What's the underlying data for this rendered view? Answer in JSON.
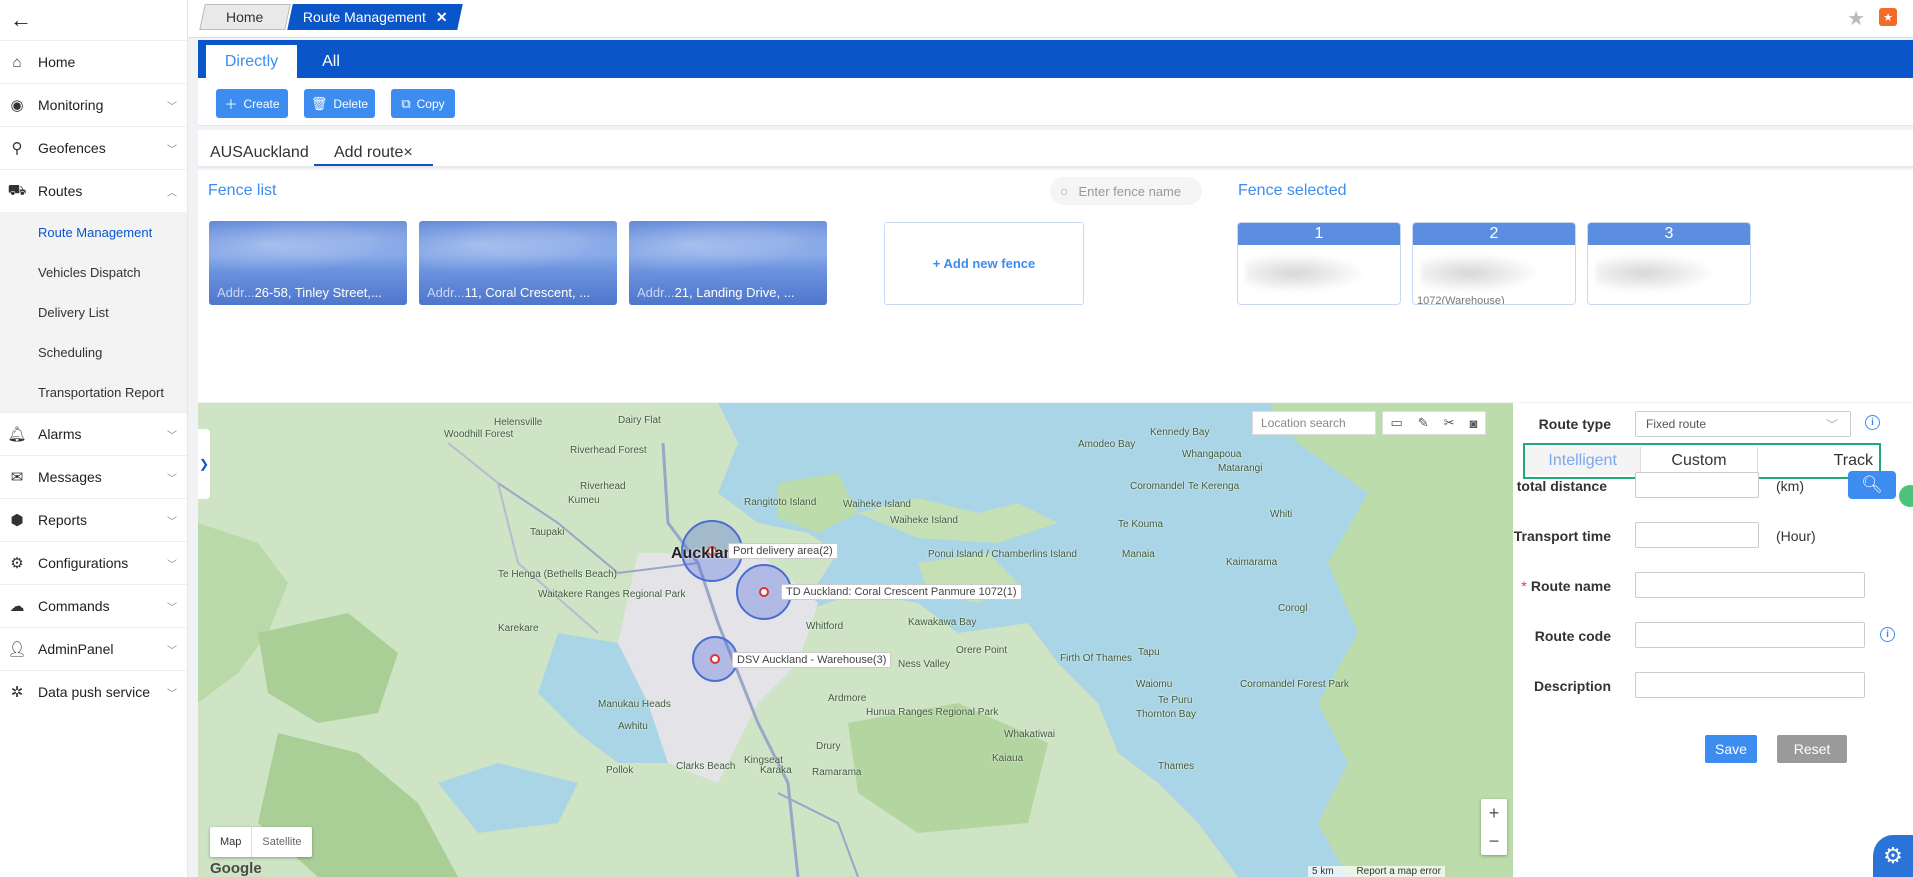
{
  "sidebar": {
    "back_icon": "arrow-left-icon",
    "items": [
      {
        "key": "home",
        "label": "Home",
        "icon": "home-icon"
      },
      {
        "key": "monitoring",
        "label": "Monitoring",
        "icon": "monitoring-icon"
      },
      {
        "key": "geofences",
        "label": "Geofences",
        "icon": "geofence-icon"
      },
      {
        "key": "routes",
        "label": "Routes",
        "icon": "truck-icon",
        "expanded": true
      },
      {
        "key": "alarms",
        "label": "Alarms",
        "icon": "bell-icon"
      },
      {
        "key": "messages",
        "label": "Messages",
        "icon": "mail-icon"
      },
      {
        "key": "reports",
        "label": "Reports",
        "icon": "report-icon"
      },
      {
        "key": "configurations",
        "label": "Configurations",
        "icon": "gears-icon"
      },
      {
        "key": "commands",
        "label": "Commands",
        "icon": "command-icon"
      },
      {
        "key": "adminpanel",
        "label": "AdminPanel",
        "icon": "admin-icon"
      },
      {
        "key": "datapush",
        "label": "Data push service",
        "icon": "network-icon"
      }
    ],
    "routes_sub": [
      "Route Management",
      "Vehicles Dispatch",
      "Delivery List",
      "Scheduling",
      "Transportation Report"
    ]
  },
  "header": {
    "home_tab": "Home",
    "active_tab": "Route Management",
    "close_glyph": "✕"
  },
  "mode_tabs": {
    "directly": "Directly",
    "all": "All"
  },
  "toolbar": {
    "create": "Create",
    "delete": "Delete",
    "copy": "Copy"
  },
  "route_tabs": {
    "first": "AUSAuckland",
    "second": "Add route×"
  },
  "fence_list": {
    "title": "Fence list",
    "search_placeholder": "Enter fence name",
    "cards": [
      {
        "label": "Addr...",
        "address": "26-58, Tinley Street,..."
      },
      {
        "label": "Addr...",
        "address": "11, Coral Crescent, ..."
      },
      {
        "label": "Addr...",
        "address": "21, Landing Drive, ..."
      }
    ],
    "add_new": "+ Add new fence"
  },
  "fence_selected": {
    "title": "Fence selected",
    "cards": [
      {
        "num": "1",
        "sub": ""
      },
      {
        "num": "2",
        "sub": "1072(Warehouse)"
      },
      {
        "num": "3",
        "sub": ""
      }
    ]
  },
  "map": {
    "location_search": "Location search",
    "markers": [
      {
        "label": "Port delivery area(2)"
      },
      {
        "label": "TD Auckland: Coral Crescent Panmure 1072(1)"
      },
      {
        "label": "DSV Auckland - Warehouse(3)"
      }
    ],
    "places": [
      "Helensville",
      "Dairy Flat",
      "Woodhill Forest",
      "Riverhead Forest",
      "Riverhead",
      "Kumeu",
      "Taupaki",
      "Rangitoto Island",
      "Waiheke Island",
      "Waiheke Island",
      "Auckland",
      "Te Henga (Bethells Beach)",
      "Waitakere Ranges Regional Park",
      "Karekare",
      "Whitford",
      "Kawakawa Bay",
      "Orere Point",
      "Ness Valley",
      "Ardmore",
      "Hunua Ranges Regional Park",
      "Manukau Heads",
      "Awhitu",
      "Drury",
      "Clarks Beach",
      "Kingseat",
      "Pollok",
      "Karaka",
      "Ramarama",
      "Whakatiwai",
      "Kaiaua",
      "Ponui Island / Chamberlins Island",
      "Firth Of Thames",
      "Amodeo Bay",
      "Kennedy Bay",
      "Whangapoua",
      "Matarangi",
      "Coromandel",
      "Te Kerenga",
      "Te Kouma",
      "Manaia",
      "Whiti",
      "Kaimarama",
      "Tapu",
      "Waiomu",
      "Te Puru",
      "Thornton Bay",
      "Thames",
      "Coromandel Forest Park",
      "Corogl"
    ],
    "type_map": "Map",
    "type_satellite": "Satellite",
    "google": "Google",
    "scale": "5 km",
    "report": "Report a map error"
  },
  "route_form": {
    "route_type_label": "Route type",
    "route_type_value": "Fixed route",
    "modes": [
      "Intelligent",
      "Custom",
      "Track"
    ],
    "total_distance_label": "total distance",
    "total_distance_unit": "(km)",
    "transport_time_label": "Transport time",
    "transport_time_unit": "(Hour)",
    "route_name_label": "Route name",
    "route_code_label": "Route code",
    "description_label": "Description",
    "save": "Save",
    "reset": "Reset"
  },
  "colors": {
    "brand": "#0a55c8",
    "button": "#3d8cf0",
    "highlight": "#1faa7a"
  }
}
